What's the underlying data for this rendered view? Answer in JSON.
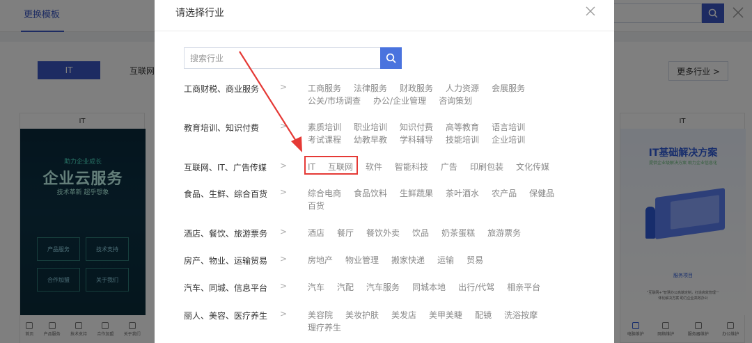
{
  "background": {
    "tab_label": "更换模板",
    "active_chip": "IT",
    "chip_next": "互联网",
    "more_button": "更多行业 >",
    "card_left": {
      "title": "IT",
      "small": "助力企业成长",
      "big": "企业云服务",
      "sub": "技术革新 超乎想象",
      "buttons": [
        "产品服务",
        "技术支持",
        "合作加盟",
        "关于我们"
      ],
      "nav": [
        "首页",
        "产品服务",
        "技术支持",
        "合作加盟",
        "关于我们"
      ]
    },
    "card_right": {
      "title": "IT",
      "heading": "IT基础解决方案",
      "sub": "提供企业级解决方案 助力企业信息化",
      "item_title": "服务项目",
      "item_desc_1": "\"互联网+\"智慧办公高端定制，打造高效管理一",
      "item_desc_2": "体化解决方案 助力企业高效办公",
      "nav": [
        "电脑维护",
        "网络维护",
        "服务器维护",
        "办公维护"
      ]
    }
  },
  "modal": {
    "title": "请选择行业",
    "search_placeholder": "搜索行业",
    "rows": [
      {
        "label": "工商财税、商业服务",
        "items": [
          "工商服务",
          "法律服务",
          "财政服务",
          "人力资源",
          "会展服务",
          "公关/市场调查",
          "办公/企业管理",
          "咨询策划"
        ]
      },
      {
        "label": "教育培训、知识付费",
        "items": [
          "素质培训",
          "职业培训",
          "知识付费",
          "高等教育",
          "语言培训",
          "考试课程",
          "幼教早教",
          "学科辅导",
          "技能培训",
          "企业培训"
        ]
      },
      {
        "label": "互联网、IT、广告传媒",
        "items": [
          "IT",
          "互联网",
          "软件",
          "智能科技",
          "广告",
          "印刷包装",
          "文化传媒"
        ]
      },
      {
        "label": "食品、生鲜、综合百货",
        "items": [
          "综合电商",
          "食品饮料",
          "生鲜蔬果",
          "茶叶酒水",
          "农产品",
          "保健品",
          "百货"
        ]
      },
      {
        "label": "酒店、餐饮、旅游票务",
        "items": [
          "酒店",
          "餐厅",
          "餐饮外卖",
          "饮品",
          "奶茶蛋糕",
          "旅游票务"
        ]
      },
      {
        "label": "房产、物业、运输贸易",
        "items": [
          "房地产",
          "物业管理",
          "搬家快递",
          "运输",
          "贸易"
        ]
      },
      {
        "label": "汽车、同城、信息平台",
        "items": [
          "汽车",
          "汽配",
          "汽车服务",
          "同城本地",
          "出行/代驾",
          "相亲平台"
        ]
      },
      {
        "label": "丽人、美容、医疗养生",
        "items": [
          "美容院",
          "美妆护肤",
          "美发店",
          "美甲美睫",
          "配镜",
          "洗浴按摩",
          "理疗养生"
        ]
      }
    ],
    "chevron": ">"
  },
  "colors": {
    "accent": "#4a73de",
    "highlight": "#e53935",
    "overlay": "rgba(0,0,0,0.5)"
  }
}
